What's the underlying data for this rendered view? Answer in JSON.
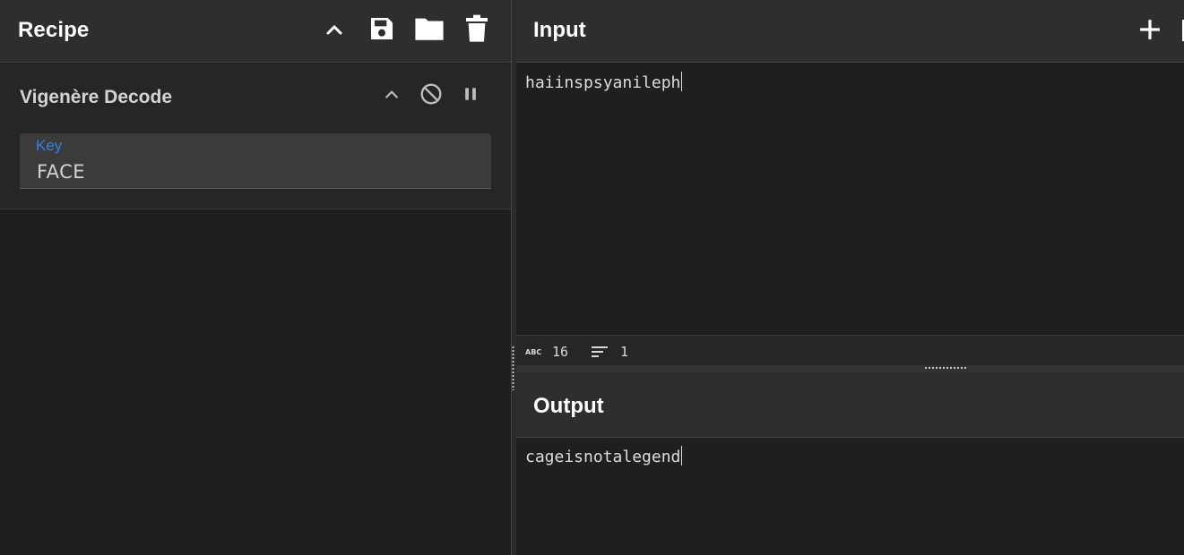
{
  "recipe": {
    "title": "Recipe",
    "operation": {
      "name": "Vigenère Decode",
      "key_label": "Key",
      "key_value": "FACE"
    }
  },
  "input": {
    "title": "Input",
    "text": "haiinspsyanileph",
    "status": {
      "length": "16",
      "lines": "1"
    }
  },
  "output": {
    "title": "Output",
    "text": "cageisnotalegend"
  },
  "icons": {
    "collapse": "chevron-up-icon",
    "save": "save-icon",
    "load": "folder-icon",
    "clear": "trash-icon",
    "disable": "disable-icon",
    "breakpoint": "pause-icon",
    "add_input": "plus-icon"
  },
  "colors": {
    "accent": "#2e84dd",
    "header_bg": "#2e2e2e",
    "pane_bg": "#1f1f1f"
  }
}
